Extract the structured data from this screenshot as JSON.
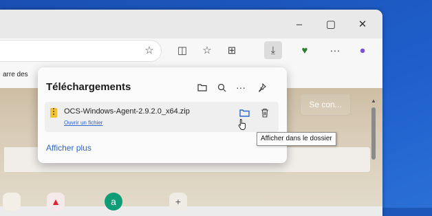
{
  "window_controls": {
    "minimize": "–",
    "maximize": "▢",
    "close": "✕"
  },
  "toolbar": {
    "favorite_icon": "☆",
    "split_icon": "◫",
    "favorites_list_icon": "☆",
    "collections_icon": "⊞",
    "downloads_icon": "⤓",
    "performance_icon": "♥",
    "more_icon": "···",
    "copilot_icon": "●"
  },
  "bookmarks": {
    "truncated_item": "arre des"
  },
  "downloads": {
    "title": "Téléchargements",
    "file_name": "OCS-Windows-Agent-2.9.2.0_x64.zip",
    "open_link": "Ouvrir un fichier",
    "show_more": "Afficher plus",
    "tooltip": "Afficher dans le dossier"
  },
  "page": {
    "sign_in": "Se con..."
  }
}
